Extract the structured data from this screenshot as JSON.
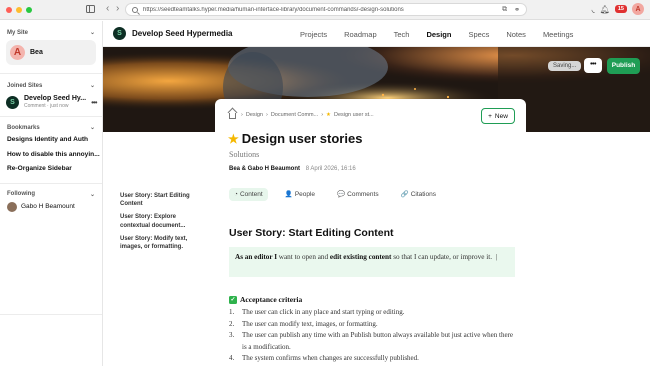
{
  "browser": {
    "url": "https://seedteamtalks.hyper.media/human-interface-library/document-commands/-design-solutions",
    "notification_count": "15",
    "avatar_letter": "A"
  },
  "sidebar": {
    "my_site_label": "My Site",
    "my_site_name": "Bea",
    "my_site_avatar_letter": "A",
    "joined_label": "Joined Sites",
    "joined_site": {
      "name": "Develop Seed Hy...",
      "sub": "Comment · just now",
      "logo_letter": "S"
    },
    "bookmarks_label": "Bookmarks",
    "bookmarks": [
      "Designs Identity and Auth",
      "How to disable this annoyin...",
      "Re-Organize Sidebar"
    ],
    "following_label": "Following",
    "following": [
      "Gabo H Beamount"
    ]
  },
  "site_header": {
    "logo_letter": "S",
    "site_name": "Develop Seed Hypermedia",
    "nav": [
      "Projects",
      "Roadmap",
      "Tech",
      "Design",
      "Specs",
      "Notes",
      "Meetings"
    ],
    "active_nav": "Design"
  },
  "hero": {
    "saving_label": "Saving...",
    "more_label": "•••",
    "publish_label": "Publish"
  },
  "document": {
    "breadcrumbs": [
      "Design",
      "Document Comm...",
      "Design user st..."
    ],
    "new_label": "New",
    "title": "Design user stories",
    "subtitle": "Solutions",
    "authors": "Bea & Gabo H Beaumont",
    "date": "8 April 2026, 16:16",
    "tabs": [
      {
        "icon": "◔",
        "label": "Content"
      },
      {
        "icon": "👤",
        "label": "People"
      },
      {
        "icon": "💬",
        "label": "Comments"
      },
      {
        "icon": "🔗",
        "label": "Citations"
      }
    ],
    "heading": "User Story: Start Editing Content",
    "callout_pre": "As an editor I",
    "callout_mid1": " want to open and ",
    "callout_bold": "edit existing content",
    "callout_post": " so that I can update, or improve it.",
    "criteria_label": "Acceptance criteria",
    "criteria": [
      "The user can click in any place and start typing or editing.",
      "The user can modify text, images, or formatting.",
      "The user can publish any time with an Publish button always available but just active when there is a modification.",
      "The system confirms when changes are successfully published."
    ]
  },
  "outline": [
    "User Story: Start Editing Content",
    "User Story: Explore contextual document...",
    "User Story: Modify text, images, or formatting."
  ]
}
